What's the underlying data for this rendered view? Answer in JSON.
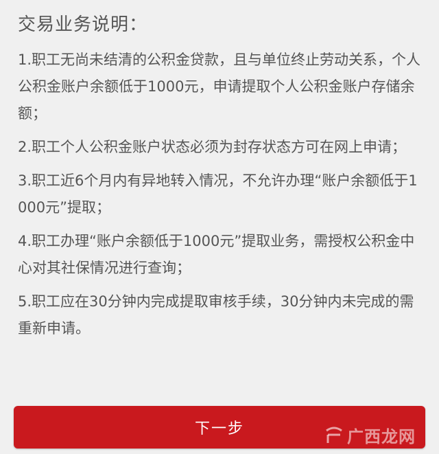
{
  "page": {
    "title": "交易业务说明："
  },
  "instructions": [
    {
      "text": "1.职工无尚未结清的公积金贷款，且与单位终止劳动关系，个人公积金账户余额低于1000元，申请提取个人公积金账户存储余额；"
    },
    {
      "text": "2.职工个人公积金账户状态必须为封存状态方可在网上申请；"
    },
    {
      "text": "3.职工近6个月内有异地转入情况，不允许办理“账户余额低于1000元”提取；"
    },
    {
      "text": "4.职工办理“账户余额低于1000元”提取业务，需授权公积金中心对其社保情况进行查询；"
    },
    {
      "text": "5.职工应在30分钟内完成提取审核手续，30分钟内未完成的需重新申请。"
    }
  ],
  "actions": {
    "next_label": "下一步"
  },
  "watermark": {
    "text": "广西龙网",
    "icon": "watermark-logo-icon"
  },
  "colors": {
    "background": "#f0f0f0",
    "text": "#555555",
    "accent": "#c9191e",
    "button_text": "#ffffff"
  }
}
